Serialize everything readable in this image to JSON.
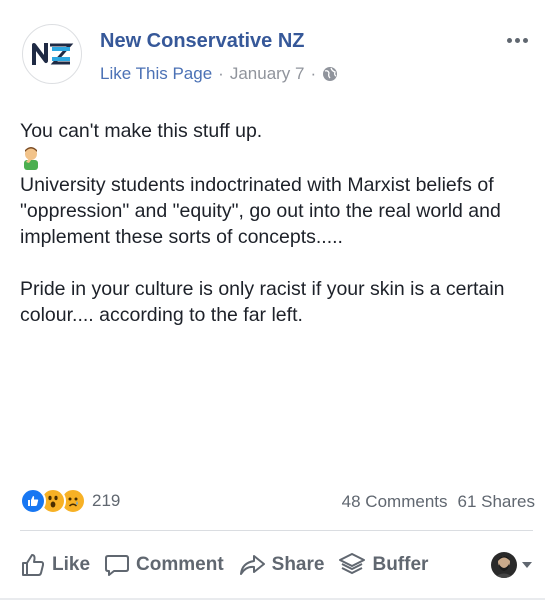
{
  "post": {
    "page_name": "New Conservative NZ",
    "logo_text": "NZ",
    "like_page_label": "Like This Page",
    "separator": "·",
    "date": "January 7",
    "audience_icon": "globe-icon",
    "text_line_1": "You can't make this stuff up.",
    "emoji": "person-facepalming-emoji",
    "paragraph_1": "University students indoctrinated with Marxist beliefs of \"oppression\" and \"equity\", go out into the real world and implement these sorts of concepts.....",
    "paragraph_2": "Pride in your culture is only racist if your skin is a certain colour.... according to the far left."
  },
  "reactions": {
    "icons": [
      "like-reaction-icon",
      "wow-reaction-icon",
      "sad-reaction-icon"
    ],
    "count": "219",
    "comments": "48 Comments",
    "shares": "61 Shares"
  },
  "actions": {
    "like": "Like",
    "comment": "Comment",
    "share": "Share",
    "buffer": "Buffer"
  },
  "colors": {
    "brand_blue": "#365899",
    "link_blue": "#4b71b5",
    "text": "#1d2129",
    "muted": "#606770",
    "like_blue": "#1877f2",
    "reaction_yellow": "#f7b125"
  }
}
